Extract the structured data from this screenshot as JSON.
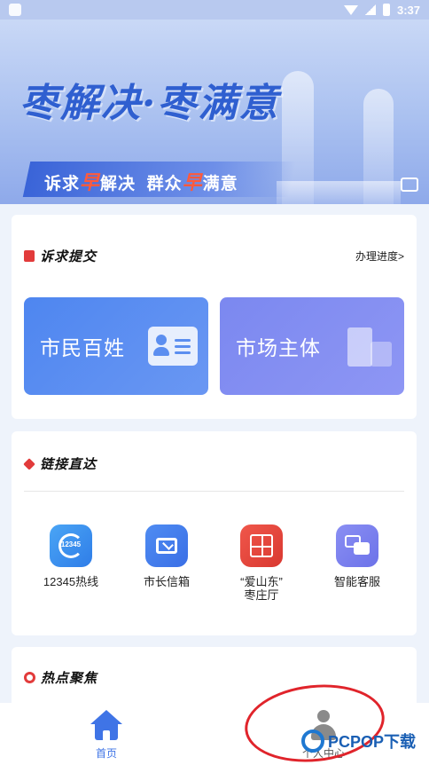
{
  "status_bar": {
    "time": "3:37"
  },
  "banner": {
    "slogan": "枣解决·枣满意",
    "sub_part1": "诉求",
    "sub_hl1": "早",
    "sub_part2": "解决  群众",
    "sub_hl2": "早",
    "sub_part3": "满意"
  },
  "complaint": {
    "title": "诉求提交",
    "progress_link": "办理进度>",
    "citizen_label": "市民百姓",
    "market_label": "市场主体"
  },
  "links": {
    "title": "链接直达",
    "hotline_num": "12345",
    "items": [
      {
        "label": "12345热线"
      },
      {
        "label": "市长信箱"
      },
      {
        "label": "“爱山东”\n枣庄厅"
      },
      {
        "label": "智能客服"
      }
    ]
  },
  "hot": {
    "title": "热点聚焦"
  },
  "nav": {
    "home": "首页",
    "me": "个人中心"
  },
  "watermark": {
    "text": "PCPOP下载"
  },
  "colors": {
    "primary": "#3f74e6",
    "accent_red": "#e23b3b",
    "annotation_red": "#e0242b"
  }
}
